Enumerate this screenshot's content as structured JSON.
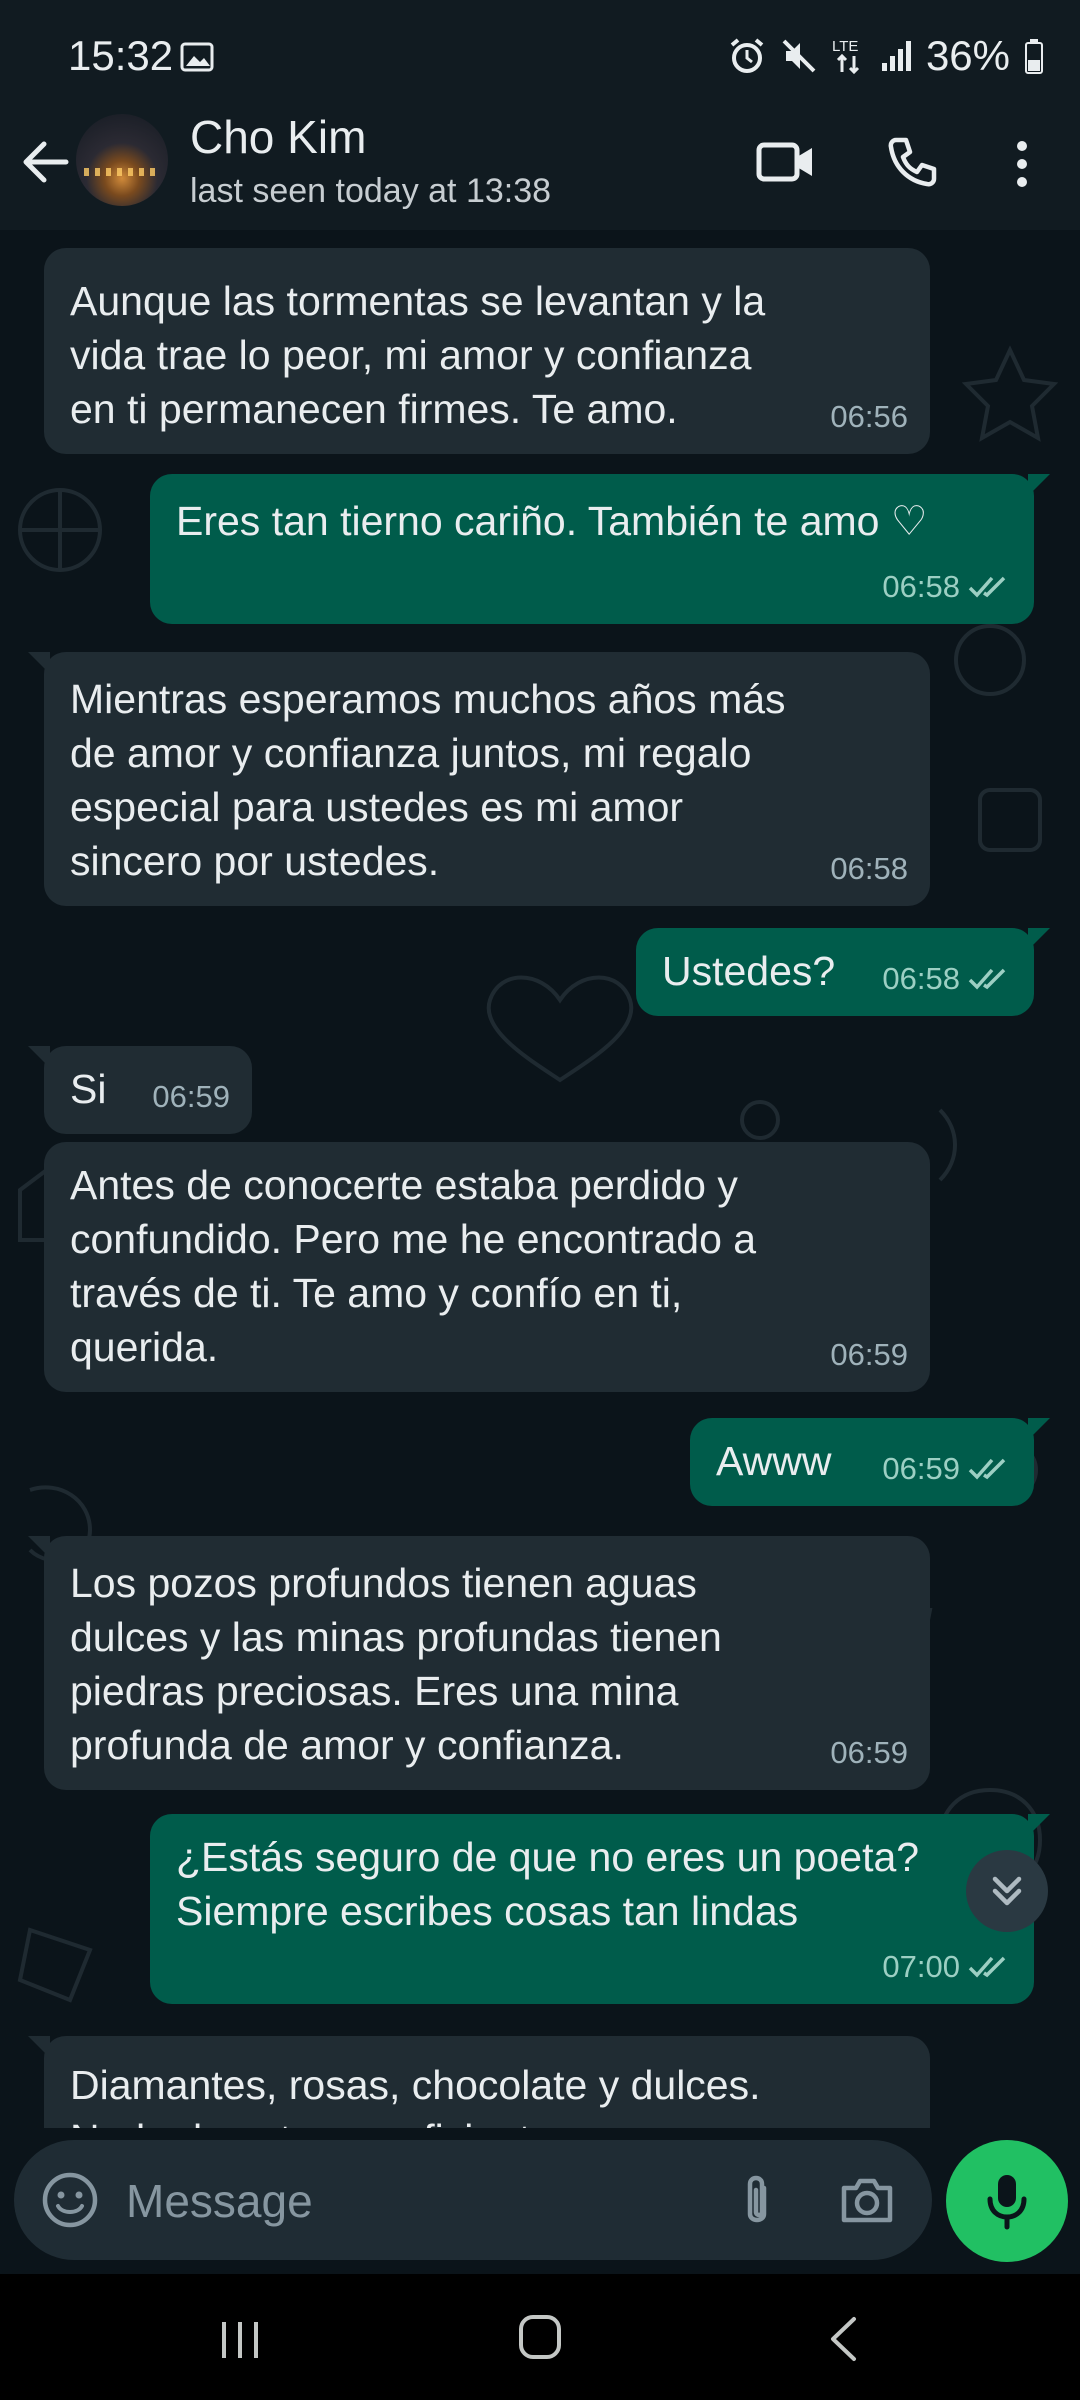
{
  "status_bar": {
    "time": "15:32",
    "battery": "36%",
    "icons": [
      "image-icon",
      "alarm-icon",
      "mute-icon",
      "lte-icon",
      "signal-icon",
      "battery-icon"
    ]
  },
  "header": {
    "contact_name": "Cho Kim",
    "last_seen": "last seen today at 13:38",
    "icons": [
      "back-arrow-icon",
      "video-call-icon",
      "phone-icon",
      "more-vert-icon"
    ]
  },
  "messages": [
    {
      "direction": "in",
      "text": "Aunque las tormentas se levantan y la vida trae lo peor, mi amor y confianza en ti permanecen firmes. Te amo.",
      "time": "06:56"
    },
    {
      "direction": "out",
      "text": "Eres tan tierno cariño. También te amo ♡",
      "time": "06:58",
      "status": "read"
    },
    {
      "direction": "in",
      "text": "Mientras esperamos muchos años más de amor y confianza juntos, mi regalo especial para ustedes es mi amor sincero por ustedes.",
      "time": "06:58"
    },
    {
      "direction": "out",
      "text": "Ustedes?",
      "time": "06:58",
      "status": "read"
    },
    {
      "direction": "in",
      "text": "Si",
      "time": "06:59"
    },
    {
      "direction": "in",
      "text": "Antes de conocerte estaba perdido y confundido. Pero me he encontrado a través de ti. Te amo y confío en ti, querida.",
      "time": "06:59"
    },
    {
      "direction": "out",
      "text": "Awww",
      "time": "06:59",
      "status": "read"
    },
    {
      "direction": "in",
      "text": "Los pozos profundos tienen aguas dulces y las minas profundas tienen piedras preciosas. Eres una mina profunda de amor y confianza.",
      "time": "06:59"
    },
    {
      "direction": "out",
      "text": "¿Estás seguro de que no eres un poeta? Siempre escribes cosas tan lindas",
      "time": "07:00",
      "status": "read"
    },
    {
      "direction": "in",
      "text": "Diamantes, rosas, chocolate y dulces. Nada de esto es suficiente para expresar",
      "time": ""
    }
  ],
  "input": {
    "placeholder": "Message",
    "value": ""
  },
  "colors": {
    "background": "#0b141a",
    "incoming_bubble": "#202c33",
    "outgoing_bubble": "#005c4b",
    "mic_button": "#21c063",
    "read_tick": "#9ccfc3"
  }
}
